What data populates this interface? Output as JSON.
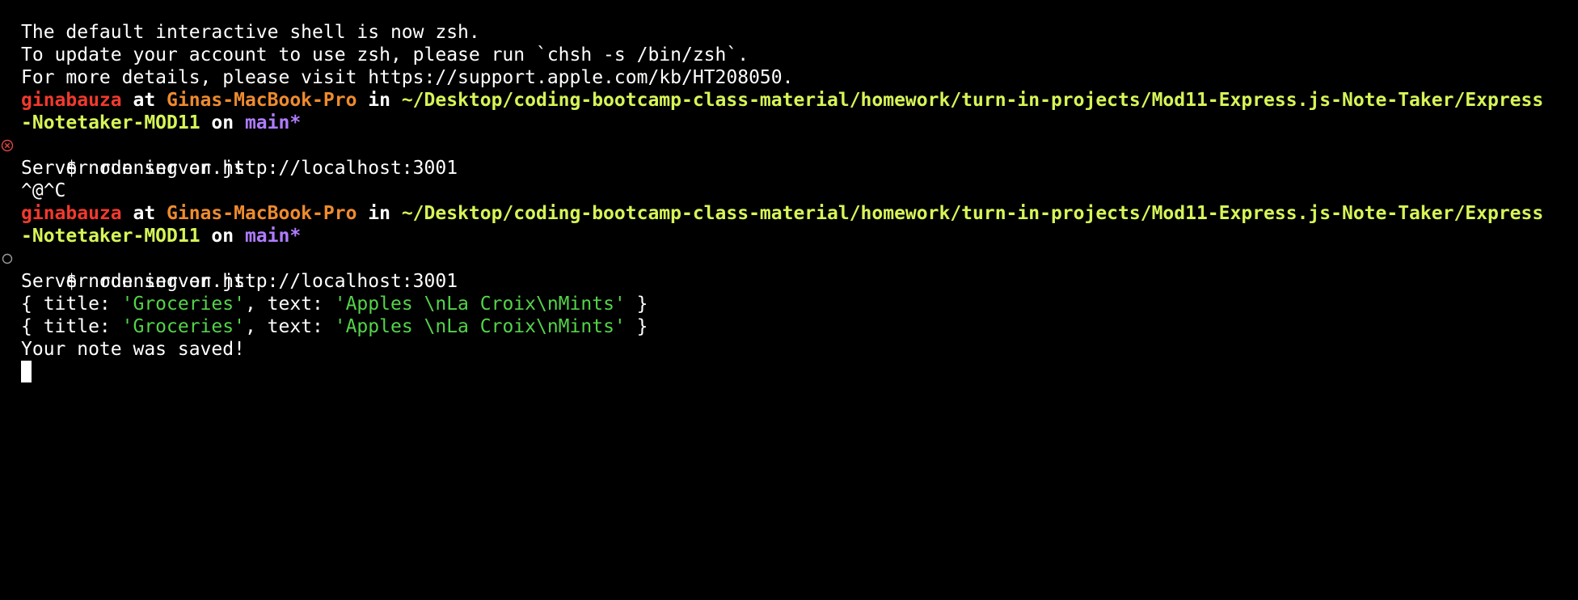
{
  "intro": {
    "line1": "The default interactive shell is now zsh.",
    "line2": "To update your account to use zsh, please run `chsh -s /bin/zsh`.",
    "line3": "For more details, please visit https://support.apple.com/kb/HT208050."
  },
  "prompt": {
    "user": "ginabauza",
    "at": " at ",
    "host": "Ginas-MacBook-Pro",
    "in": " in ",
    "path_line1": "~/Desktop/coding-bootcamp-class-material/homework/turn-in-projects/Mod11-Express.js-Note-Taker/Express",
    "path_line2": "-Notetaker-MOD11",
    "on": " on ",
    "branch": "main*"
  },
  "session1": {
    "command": "$ node server.js",
    "output1": "Server running on http://localhost:3001",
    "output2": "^@^C"
  },
  "session2": {
    "command": "$ node server.js",
    "output1": "Server running on http://localhost:3001",
    "log_open": "{ title: ",
    "log_title": "'Groceries'",
    "log_mid": ", text: ",
    "log_text": "'Apples \\nLa Croix\\nMints'",
    "log_close": " }",
    "saved": "Your note was saved!"
  },
  "colors": {
    "background": "#000000",
    "text": "#ffffff",
    "user": "#f2392d",
    "host": "#ee8b2e",
    "path": "#d6f557",
    "branch": "#b07cff",
    "string": "#53d449",
    "error_marker": "#e0463f",
    "idle_marker": "#9a9a9a"
  },
  "icons": {
    "error_marker": "circled-x-icon",
    "running_marker": "circle-outline-icon"
  }
}
